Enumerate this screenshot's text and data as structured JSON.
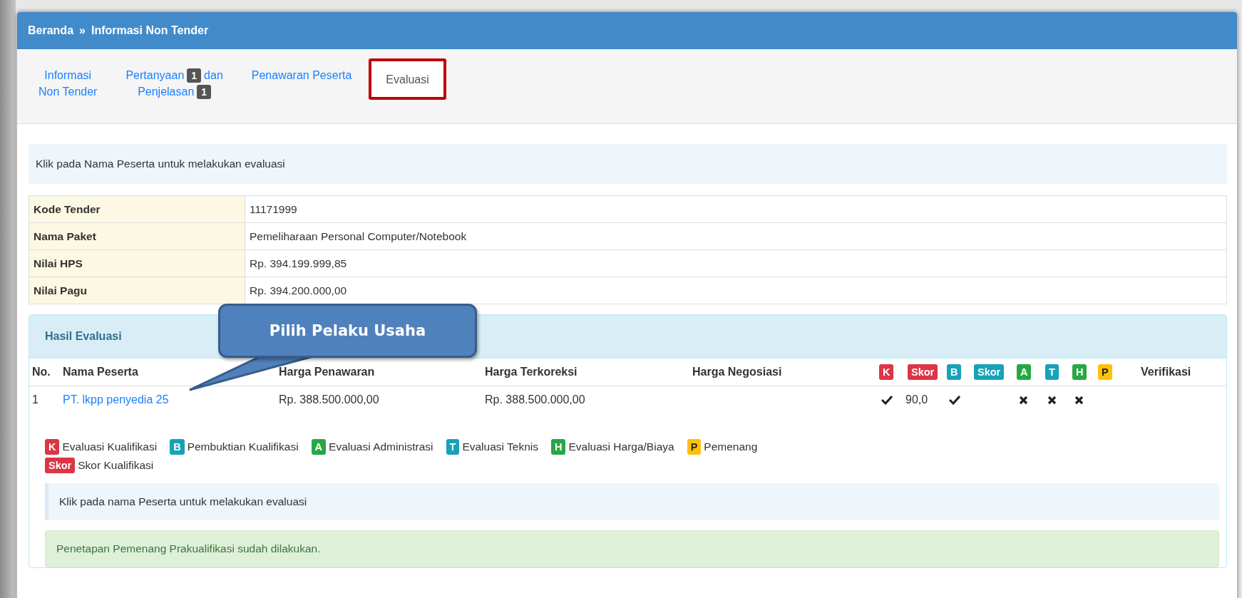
{
  "breadcrumb": {
    "items": [
      "Beranda",
      "Informasi Non Tender"
    ],
    "separator": "»"
  },
  "tabs": [
    {
      "lines": [
        [
          {
            "kind": "text",
            "text": "Informasi"
          }
        ],
        [
          {
            "kind": "text",
            "text": "Non Tender"
          }
        ]
      ],
      "selected": false
    },
    {
      "lines": [
        [
          {
            "kind": "text",
            "text": "Pertanyaan"
          },
          {
            "kind": "badge",
            "text": "1"
          },
          {
            "kind": "text",
            "text": "dan"
          }
        ],
        [
          {
            "kind": "text",
            "text": "Penjelasan"
          },
          {
            "kind": "badge",
            "text": "1"
          }
        ]
      ],
      "selected": false
    },
    {
      "lines": [
        [
          {
            "kind": "text",
            "text": "Penawaran Peserta"
          }
        ]
      ],
      "selected": false
    },
    {
      "lines": [
        [
          {
            "kind": "text",
            "text": "Evaluasi"
          }
        ]
      ],
      "selected": true
    }
  ],
  "info": "Klik pada Nama Peserta untuk melakukan evaluasi",
  "details": [
    {
      "label": "Kode Tender",
      "value": "11171999"
    },
    {
      "label": "Nama Paket",
      "value": "Pemeliharaan Personal Computer/Notebook"
    },
    {
      "label": "Nilai HPS",
      "value": "Rp. 394.199.999,85"
    },
    {
      "label": "Nilai Pagu",
      "value": "Rp. 394.200.000,00"
    }
  ],
  "hasil": {
    "title": "Hasil Evaluasi",
    "callout": "Pilih Pelaku Usaha",
    "columns": [
      "No.",
      "Nama Peserta",
      "Harga Penawaran",
      "Harga Terkoreksi",
      "Harga Negosiasi"
    ],
    "eval_columns": [
      {
        "label": "K",
        "color": "#dc3545"
      },
      {
        "label": "Skor",
        "color": "#dc3545"
      },
      {
        "label": "B",
        "color": "#17a2b8"
      },
      {
        "label": "Skor",
        "color": "#17a2b8"
      },
      {
        "label": "A",
        "color": "#28a745"
      },
      {
        "label": "T",
        "color": "#17a2b8"
      },
      {
        "label": "H",
        "color": "#28a745"
      },
      {
        "label": "P",
        "color": "#ffc107"
      }
    ],
    "last_column": "Verifikasi",
    "rows": [
      {
        "no": "1",
        "name": "PT. lkpp penyedia 25",
        "penawaran": "Rp. 388.500.000,00",
        "terkoreksi": "Rp. 388.500.000,00",
        "evals": [
          {
            "kind": "check"
          },
          {
            "kind": "text",
            "text": "90,0"
          },
          {
            "kind": "check"
          },
          {
            "kind": "empty"
          },
          {
            "kind": "cross"
          },
          {
            "kind": "cross"
          },
          {
            "kind": "cross"
          },
          {
            "kind": "empty"
          }
        ]
      }
    ],
    "legend": [
      {
        "badge": "K",
        "color": "#dc3545",
        "text": "Evaluasi Kualifikasi"
      },
      {
        "badge": "B",
        "color": "#17a2b8",
        "text": "Pembuktian Kualifikasi"
      },
      {
        "badge": "A",
        "color": "#28a745",
        "text": "Evaluasi Administrasi"
      },
      {
        "badge": "T",
        "color": "#17a2b8",
        "text": "Evaluasi Teknis"
      },
      {
        "badge": "H",
        "color": "#28a745",
        "text": "Evaluasi Harga/Biaya"
      },
      {
        "badge": "P",
        "color": "#ffc107",
        "text": "Pemenang"
      },
      {
        "badge": "Skor",
        "color": "#dc3545",
        "text": "Skor Kualifikasi"
      }
    ],
    "note": "Klik pada nama Peserta untuk melakukan evaluasi",
    "success": "Penetapan Pemenang Prakualifikasi sudah dilakukan."
  }
}
